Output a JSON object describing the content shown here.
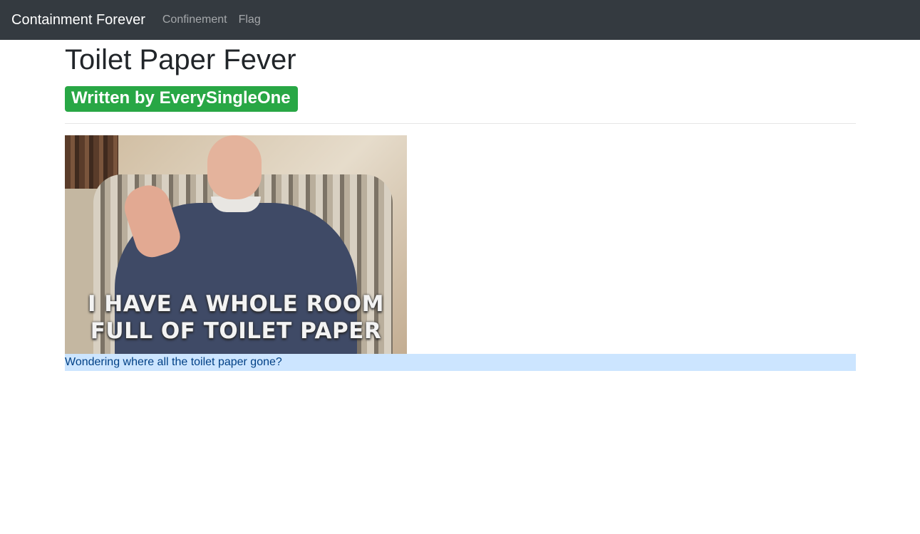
{
  "navbar": {
    "brand": "Containment Forever",
    "links": [
      "Confinement",
      "Flag"
    ]
  },
  "main": {
    "title": "Toilet Paper Fever",
    "author_badge": "Written by EverySingleOne",
    "gif": {
      "caption_line1": "I HAVE A WHOLE ROOM",
      "caption_line2": "FULL OF TOILET PAPER"
    },
    "caption": "Wondering where all the toilet paper gone?"
  },
  "colors": {
    "navbar_bg": "#343a40",
    "badge_bg": "#28a745",
    "caption_bg": "#cce5ff",
    "caption_text": "#004085"
  }
}
